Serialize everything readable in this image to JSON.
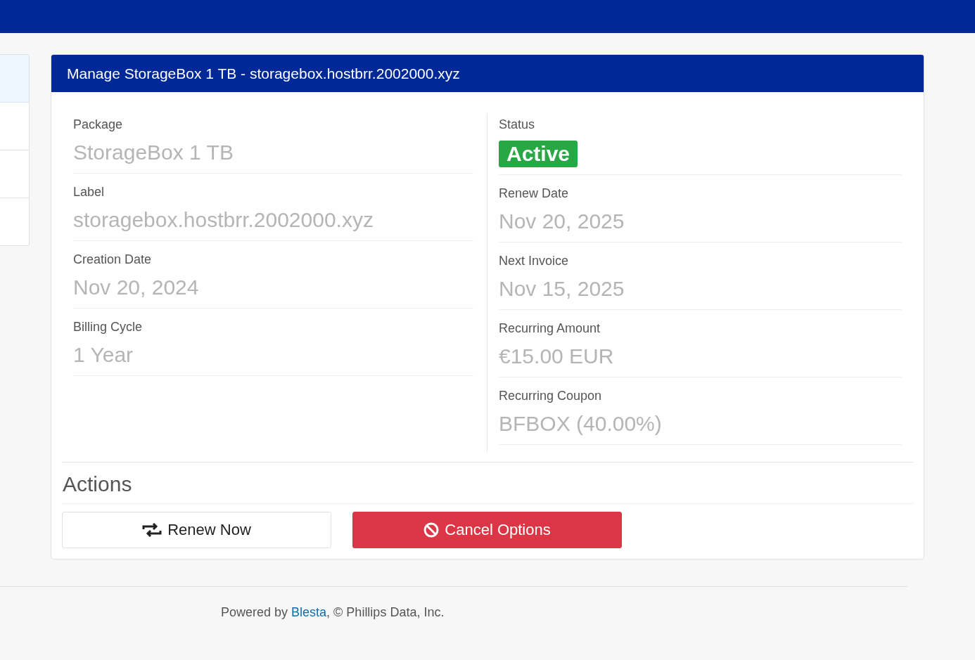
{
  "sidebar": {
    "items": [
      {
        "selected": true
      },
      {
        "selected": false
      },
      {
        "selected": false
      },
      {
        "selected": false
      }
    ]
  },
  "panel": {
    "title": "Manage StorageBox 1 TB - storagebox.hostbrr.2002000.xyz",
    "left_fields": [
      {
        "label": "Package",
        "value": "StorageBox 1 TB"
      },
      {
        "label": "Label",
        "value": "storagebox.hostbrr.2002000.xyz"
      },
      {
        "label": "Creation Date",
        "value": "Nov 20, 2024"
      },
      {
        "label": "Billing Cycle",
        "value": "1 Year"
      }
    ],
    "status": {
      "label": "Status",
      "value": "Active",
      "kind": "success"
    },
    "right_fields": [
      {
        "label": "Renew Date",
        "value": "Nov 20, 2025"
      },
      {
        "label": "Next Invoice",
        "value": "Nov 15, 2025"
      },
      {
        "label": "Recurring Amount",
        "value": "€15.00 EUR"
      },
      {
        "label": "Recurring Coupon",
        "value": "BFBOX (40.00%)"
      }
    ],
    "actions_title": "Actions",
    "actions": [
      {
        "kind": "renew",
        "label": "Renew Now"
      },
      {
        "kind": "cancel",
        "label": "Cancel Options"
      }
    ]
  },
  "footer": {
    "prefix": "Powered by ",
    "link": "Blesta",
    "suffix": ", © Phillips Data, Inc."
  }
}
